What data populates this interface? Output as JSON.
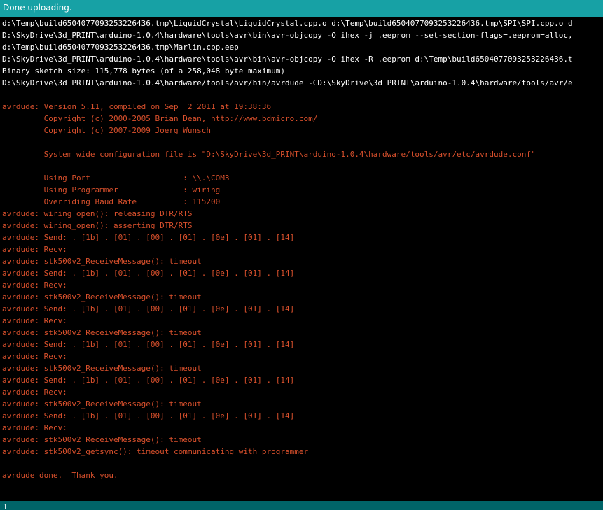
{
  "status_bar": {
    "message": "Done uploading."
  },
  "console": {
    "lines": [
      {
        "text": "d:\\Temp\\build6504077093253226436.tmp\\LiquidCrystal\\LiquidCrystal.cpp.o d:\\Temp\\build6504077093253226436.tmp\\SPI\\SPI.cpp.o d",
        "color": "white"
      },
      {
        "text": "D:\\SkyDrive\\3d_PRINT\\arduino-1.0.4\\hardware\\tools\\avr\\bin\\avr-objcopy -O ihex -j .eeprom --set-section-flags=.eeprom=alloc,",
        "color": "white"
      },
      {
        "text": "d:\\Temp\\build6504077093253226436.tmp\\Marlin.cpp.eep",
        "color": "white"
      },
      {
        "text": "D:\\SkyDrive\\3d_PRINT\\arduino-1.0.4\\hardware\\tools\\avr\\bin\\avr-objcopy -O ihex -R .eeprom d:\\Temp\\build6504077093253226436.t",
        "color": "white"
      },
      {
        "text": "Binary sketch size: 115,778 bytes (of a 258,048 byte maximum)",
        "color": "white"
      },
      {
        "text": "D:\\SkyDrive\\3d_PRINT\\arduino-1.0.4\\hardware/tools/avr/bin/avrdude -CD:\\SkyDrive\\3d_PRINT\\arduino-1.0.4\\hardware/tools/avr/e",
        "color": "white"
      },
      {
        "text": "",
        "color": "error"
      },
      {
        "text": "avrdude: Version 5.11, compiled on Sep  2 2011 at 19:38:36",
        "color": "error"
      },
      {
        "text": "         Copyright (c) 2000-2005 Brian Dean, http://www.bdmicro.com/",
        "color": "error"
      },
      {
        "text": "         Copyright (c) 2007-2009 Joerg Wunsch",
        "color": "error"
      },
      {
        "text": "",
        "color": "error"
      },
      {
        "text": "         System wide configuration file is \"D:\\SkyDrive\\3d_PRINT\\arduino-1.0.4\\hardware/tools/avr/etc/avrdude.conf\"",
        "color": "error"
      },
      {
        "text": "",
        "color": "error"
      },
      {
        "text": "         Using Port                    : \\\\.\\COM3",
        "color": "error"
      },
      {
        "text": "         Using Programmer              : wiring",
        "color": "error"
      },
      {
        "text": "         Overriding Baud Rate          : 115200",
        "color": "error"
      },
      {
        "text": "avrdude: wiring_open(): releasing DTR/RTS",
        "color": "error"
      },
      {
        "text": "avrdude: wiring_open(): asserting DTR/RTS",
        "color": "error"
      },
      {
        "text": "avrdude: Send: . [1b] . [01] . [00] . [01] . [0e] . [01] . [14]",
        "color": "error"
      },
      {
        "text": "avrdude: Recv:",
        "color": "error"
      },
      {
        "text": "avrdude: stk500v2_ReceiveMessage(): timeout",
        "color": "error"
      },
      {
        "text": "avrdude: Send: . [1b] . [01] . [00] . [01] . [0e] . [01] . [14]",
        "color": "error"
      },
      {
        "text": "avrdude: Recv:",
        "color": "error"
      },
      {
        "text": "avrdude: stk500v2_ReceiveMessage(): timeout",
        "color": "error"
      },
      {
        "text": "avrdude: Send: . [1b] . [01] . [00] . [01] . [0e] . [01] . [14]",
        "color": "error"
      },
      {
        "text": "avrdude: Recv:",
        "color": "error"
      },
      {
        "text": "avrdude: stk500v2_ReceiveMessage(): timeout",
        "color": "error"
      },
      {
        "text": "avrdude: Send: . [1b] . [01] . [00] . [01] . [0e] . [01] . [14]",
        "color": "error"
      },
      {
        "text": "avrdude: Recv:",
        "color": "error"
      },
      {
        "text": "avrdude: stk500v2_ReceiveMessage(): timeout",
        "color": "error"
      },
      {
        "text": "avrdude: Send: . [1b] . [01] . [00] . [01] . [0e] . [01] . [14]",
        "color": "error"
      },
      {
        "text": "avrdude: Recv:",
        "color": "error"
      },
      {
        "text": "avrdude: stk500v2_ReceiveMessage(): timeout",
        "color": "error"
      },
      {
        "text": "avrdude: Send: . [1b] . [01] . [00] . [01] . [0e] . [01] . [14]",
        "color": "error"
      },
      {
        "text": "avrdude: Recv:",
        "color": "error"
      },
      {
        "text": "avrdude: stk500v2_ReceiveMessage(): timeout",
        "color": "error"
      },
      {
        "text": "avrdude: stk500v2_getsync(): timeout communicating with programmer",
        "color": "error"
      },
      {
        "text": "",
        "color": "error"
      },
      {
        "text": "avrdude done.  Thank you.",
        "color": "error"
      },
      {
        "text": "",
        "color": "error"
      }
    ]
  },
  "line_indicator": {
    "value": "1"
  },
  "colors": {
    "status_bar_bg": "#17a1a5",
    "line_indicator_bg": "#006468",
    "console_bg": "#000000",
    "console_text": "#ffffff",
    "console_error_text": "#d9502c"
  }
}
